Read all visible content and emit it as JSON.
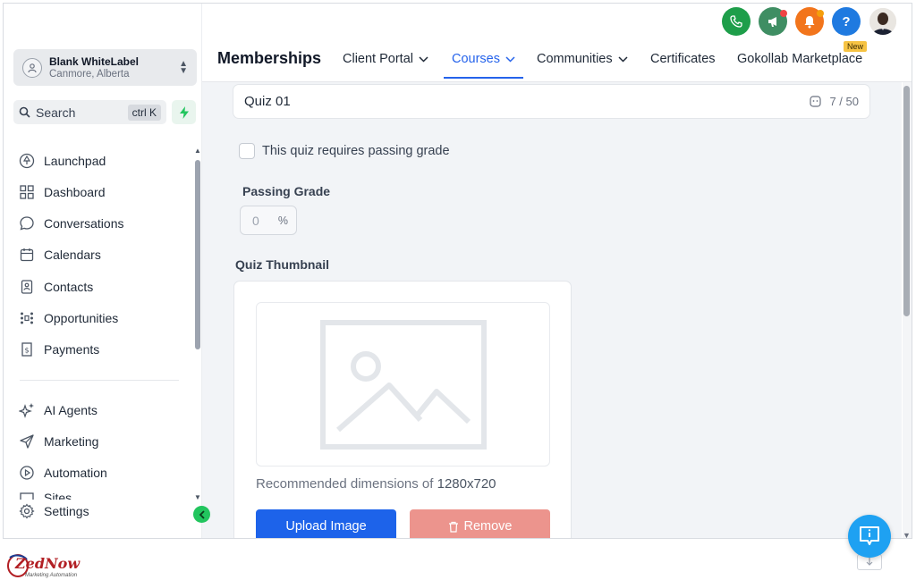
{
  "account": {
    "name": "Blank WhiteLabel",
    "location": "Canmore, Alberta"
  },
  "search": {
    "label": "Search",
    "shortcut": "ctrl K"
  },
  "sidebar": {
    "items": [
      {
        "label": "Launchpad",
        "icon": "launchpad-icon"
      },
      {
        "label": "Dashboard",
        "icon": "dashboard-icon"
      },
      {
        "label": "Conversations",
        "icon": "chat-icon"
      },
      {
        "label": "Calendars",
        "icon": "calendar-icon"
      },
      {
        "label": "Contacts",
        "icon": "contacts-icon"
      },
      {
        "label": "Opportunities",
        "icon": "opportunities-icon"
      },
      {
        "label": "Payments",
        "icon": "payments-icon"
      },
      {
        "label": "AI Agents",
        "icon": "sparkle-icon"
      },
      {
        "label": "Marketing",
        "icon": "send-icon"
      },
      {
        "label": "Automation",
        "icon": "automation-icon"
      },
      {
        "label": "Sites",
        "icon": "sites-icon"
      },
      {
        "label": "Settings",
        "icon": "gear-icon"
      }
    ]
  },
  "header": {
    "title": "Memberships",
    "tabs": [
      {
        "label": "Client Portal",
        "dropdown": true
      },
      {
        "label": "Courses",
        "dropdown": true,
        "active": true
      },
      {
        "label": "Communities",
        "dropdown": true
      },
      {
        "label": "Certificates",
        "dropdown": false
      },
      {
        "label": "Gokollab Marketplace",
        "dropdown": false
      }
    ],
    "new_badge": "New",
    "icons": [
      "phone-icon",
      "megaphone-icon",
      "bell-icon",
      "help-icon",
      "user-avatar"
    ],
    "help_glyph": "?"
  },
  "quiz": {
    "title_value": "Quiz 01",
    "char_count": "7 / 50",
    "passing_checkbox_label": "This quiz requires passing grade",
    "passing_grade_label": "Passing Grade",
    "passing_grade_value": "0",
    "passing_grade_unit": "%",
    "thumbnail_label": "Quiz Thumbnail",
    "recommended_prefix": "Recommended dimensions of ",
    "recommended_dims": "1280x720",
    "upload_label": "Upload Image",
    "remove_label": "Remove"
  },
  "branding": {
    "logo_text": "ZedNow",
    "tagline": "Marketing Automation"
  },
  "colors": {
    "primary": "#1d63ea",
    "remove": "#ec948d",
    "accent_green": "#22c55e",
    "help_fab": "#1ea1f2"
  }
}
